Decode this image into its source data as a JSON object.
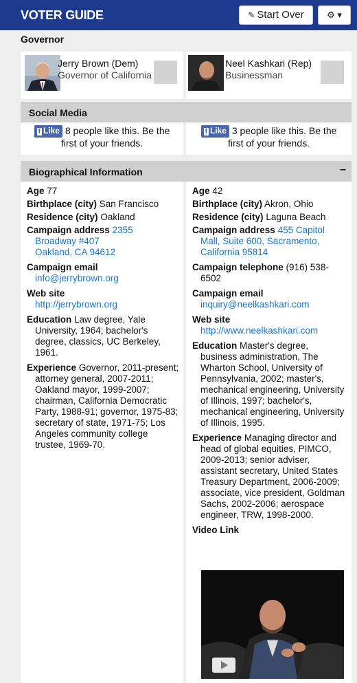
{
  "header": {
    "title": "VOTER GUIDE",
    "start_over": "Start Over",
    "start_over_icon": "edit-icon",
    "gear_icon": "gear-icon",
    "gear_label": "⚙ ▾",
    "brand_color": "#1d3a8f"
  },
  "office": "Governor",
  "candidates": [
    {
      "name": "Jerry Brown (Dem)",
      "title": "Governor of California"
    },
    {
      "name": "Neel Kashkari (Rep)",
      "title": "Businessman"
    }
  ],
  "social": {
    "heading": "Social Media",
    "like_label": "Like",
    "left_text": "8 people like this. Be the first of your friends.",
    "right_text": "3 people like this. Be the first of your friends."
  },
  "bio": {
    "heading": "Biographical Information",
    "collapse": "–",
    "left": {
      "age_label": "Age",
      "age": "77",
      "birth_label": "Birthplace (city)",
      "birth": "San Francisco",
      "res_label": "Residence (city)",
      "res": "Oakland",
      "addr_label": "Campaign address",
      "addr1": "2355",
      "addr2": "Broadway #407",
      "addr3": "Oakland, CA 94612",
      "email_label": "Campaign email",
      "email": "info@jerrybrown.org",
      "web_label": "Web site",
      "web": "http://jerrybrown.org",
      "edu_label": "Education",
      "edu": "Law degree, Yale University, 1964; bachelor's degree, classics, UC Berkeley, 1961.",
      "exp_label": "Experience",
      "exp": "Governor, 2011-present; attorney general, 2007-2011; Oakland mayor, 1999-2007; chairman, California Democratic Party, 1988-91; governor, 1975-83; secretary of state, 1971-75; Los Angeles community college trustee, 1969-70."
    },
    "right": {
      "age_label": "Age",
      "age": "42",
      "birth_label": "Birthplace (city)",
      "birth": "Akron, Ohio",
      "res_label": "Residence (city)",
      "res": "Laguna Beach",
      "addr_label": "Campaign address",
      "addr1": "455 Capitol",
      "addr2": "Mall, Suite 600, Sacramento,",
      "addr3": "California 95814",
      "tel_label": "Campaign telephone",
      "tel": "(916) 538-6502",
      "email_label": "Campaign email",
      "email": "inquiry@neelkashkari.com",
      "web_label": "Web site",
      "web": "http://www.neelkashkari.com",
      "edu_label": "Education",
      "edu": "Master's degree, business administration, The Wharton School, University of Pennsylvania, 2002; master's, mechanical engineering, University of Illinois, 1997; bachelor's, mechanical engineering, University of Illinois, 1995.",
      "exp_label": "Experience",
      "exp": "Managing director and head of global equities, PIMCO, 2009-2013; senior adviser, assistant secretary, United States Treasury Department, 2006-2009; associate, vice president, Goldman Sachs, 2002-2006; aerospace engineer, TRW, 1998-2000.",
      "video_label": "Video Link"
    }
  }
}
